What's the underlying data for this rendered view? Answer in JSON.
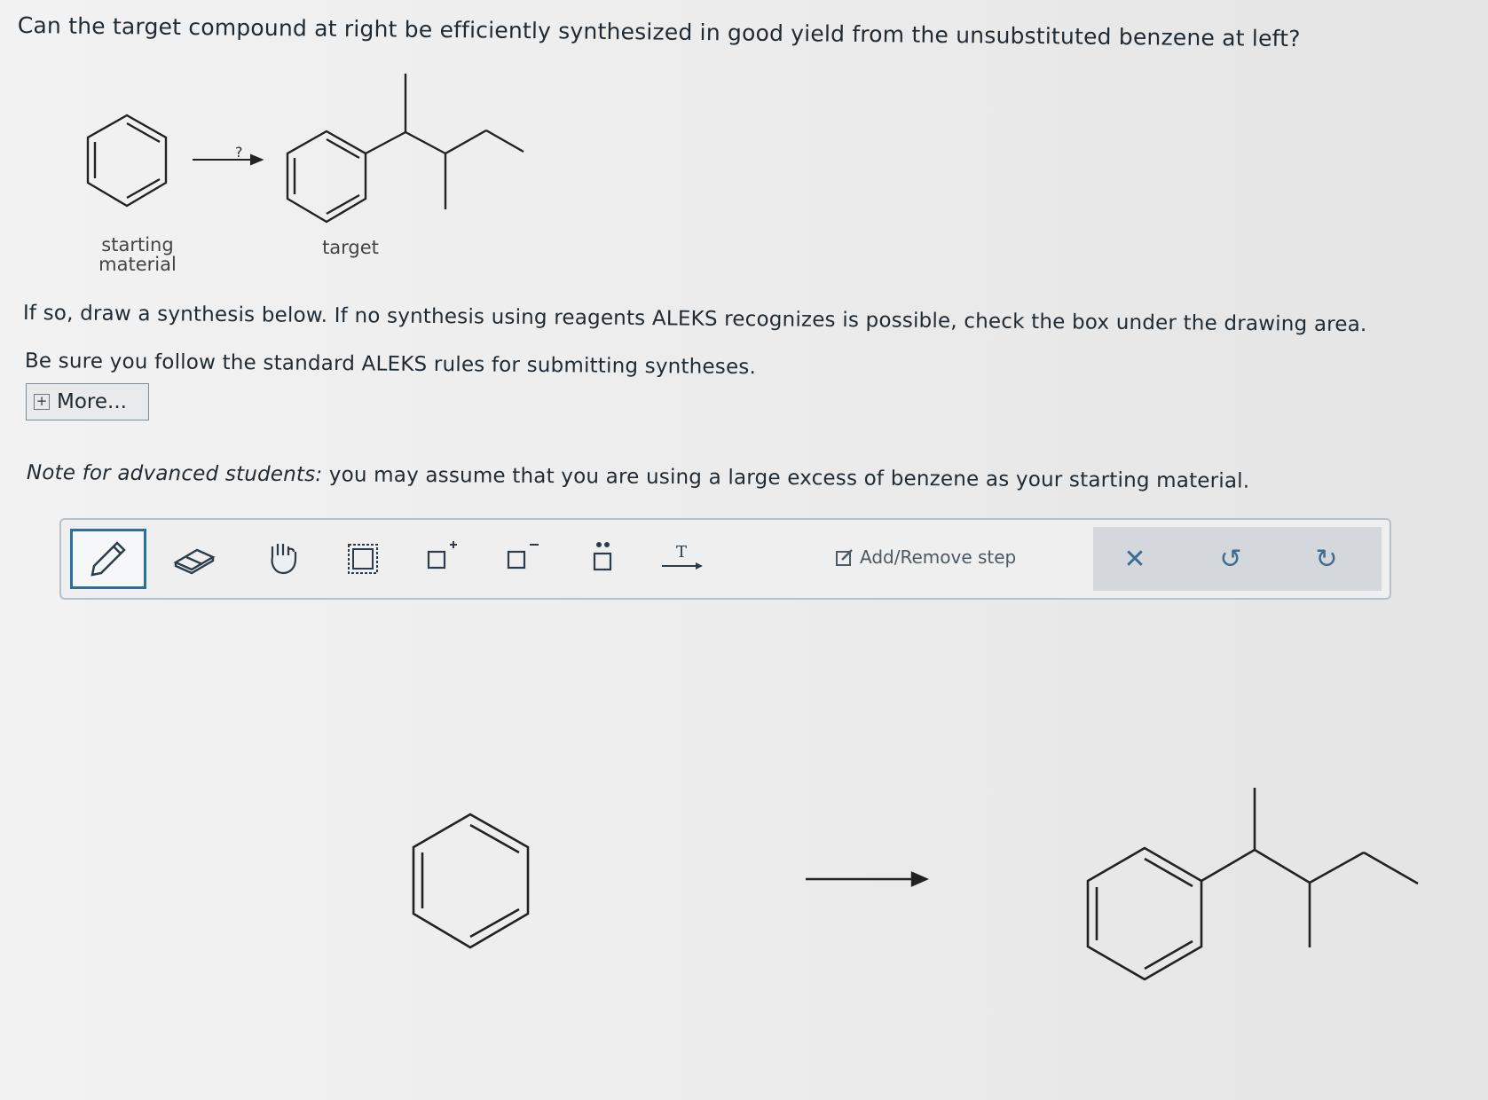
{
  "question": "Can the target compound at right be efficiently synthesized in good yield from the unsubstituted benzene at left?",
  "scheme": {
    "arrow_label": "?",
    "starting_label": "starting\nmaterial",
    "target_label": "target"
  },
  "instructions": {
    "line1": "If so, draw a synthesis below. If no synthesis using reagents ALEKS recognizes is possible, check the box under the drawing area.",
    "line2": "Be sure you follow the standard ALEKS rules for submitting syntheses."
  },
  "more_button": {
    "icon": "plus-icon",
    "label": "More..."
  },
  "note": {
    "prefix": "Note for advanced students:",
    "text": " you may assume that you are using a large excess of benzene as your starting material."
  },
  "toolbar": {
    "tools": [
      "pencil-icon",
      "eraser-icon",
      "hand-icon",
      "selection-icon",
      "positive-charge-icon",
      "negative-charge-icon",
      "lone-pair-icon",
      "arrow-text-icon"
    ],
    "add_remove_label": "Add/Remove step",
    "actions": [
      "close-icon",
      "undo-icon",
      "redo-icon"
    ]
  },
  "colors": {
    "accent": "#2a6f9e",
    "text": "#1f2a33",
    "actions_bg": "#d4d8dc"
  }
}
